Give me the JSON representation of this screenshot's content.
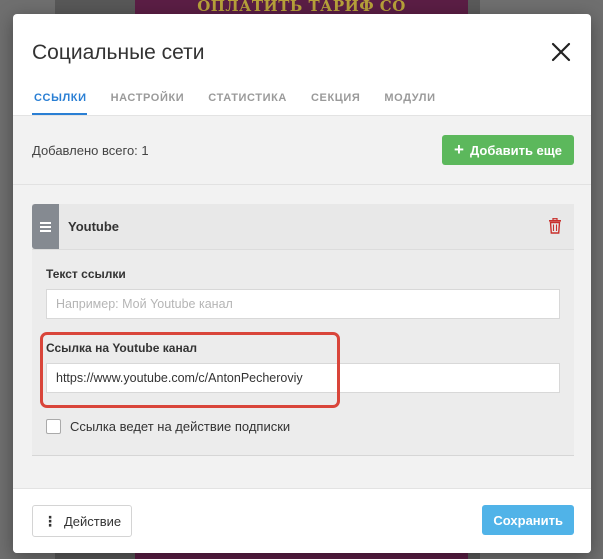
{
  "background": {
    "banner_top": "ОПЛАТИТЬ ТАРИФ СО",
    "banner_bottom": "",
    "overlay_color": "#6f6f6f"
  },
  "modal": {
    "title": "Социальные сети",
    "close_icon": "close-icon",
    "tabs": [
      {
        "label": "ССЫЛКИ",
        "active": true
      },
      {
        "label": "НАСТРОЙКИ",
        "active": false
      },
      {
        "label": "СТАТИСТИКА",
        "active": false
      },
      {
        "label": "СЕКЦИЯ",
        "active": false
      },
      {
        "label": "МОДУЛИ",
        "active": false
      }
    ],
    "accent_color": "#2a7fd4"
  },
  "body": {
    "count_text": "Добавлено всего: 1",
    "add_button": {
      "icon": "plus-icon",
      "label": "Добавить еще",
      "color": "#5cb85c"
    }
  },
  "item": {
    "title": "Youtube",
    "drag_icon": "drag-handle-icon",
    "delete_icon": "trash-icon",
    "delete_color": "#c9302c",
    "link_text_field": {
      "label": "Текст ссылки",
      "value": "",
      "placeholder": "Например: Мой Youtube канал"
    },
    "url_field": {
      "label": "Ссылка на Youtube канал",
      "value": "https://www.youtube.com/c/AntonPecheroviy",
      "placeholder": ""
    },
    "checkbox": {
      "label": "Ссылка ведет на действие подписки",
      "checked": false
    },
    "highlight_color": "#d9453a"
  },
  "footer": {
    "action_button": {
      "icon": "vertical-dots-icon",
      "label": "Действие"
    },
    "save_button": {
      "label": "Сохранить",
      "color": "#50b3e8"
    }
  }
}
